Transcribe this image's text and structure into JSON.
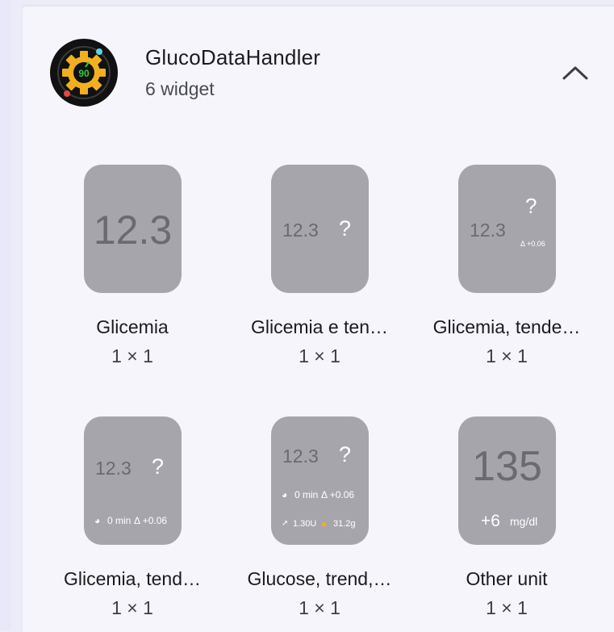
{
  "app": {
    "title": "GlucoDataHandler",
    "subtitle": "6 widget",
    "icon_value": "90"
  },
  "widgets": [
    {
      "name": "Glicemia",
      "size": "1 × 1",
      "preview": {
        "value": "12.3"
      }
    },
    {
      "name": "Glicemia e ten…",
      "size": "1 × 1",
      "preview": {
        "value": "12.3",
        "trend": "?"
      }
    },
    {
      "name": "Glicemia, tende…",
      "size": "1 × 1",
      "preview": {
        "value": "12.3",
        "trend": "?",
        "delta": "Δ +0.06"
      }
    },
    {
      "name": "Glicemia, tend…",
      "size": "1 × 1",
      "preview": {
        "value": "12.3",
        "trend": "?",
        "time": "0 min",
        "delta": "Δ +0.06"
      }
    },
    {
      "name": "Glucose, trend,…",
      "size": "1 × 1",
      "preview": {
        "value": "12.3",
        "trend": "?",
        "time": "0 min",
        "delta": "Δ +0.06",
        "insulin": "1.30U",
        "carbs": "31.2g"
      }
    },
    {
      "name": "Other unit",
      "size": "1 × 1",
      "preview": {
        "value": "135",
        "delta": "+6",
        "unit": "mg/dl"
      }
    }
  ],
  "colors": {
    "preview_bg": "#a7a5ac",
    "icon_bg": "#111111",
    "icon_gear": "#f2b01e",
    "icon_value": "#2ecc40"
  }
}
